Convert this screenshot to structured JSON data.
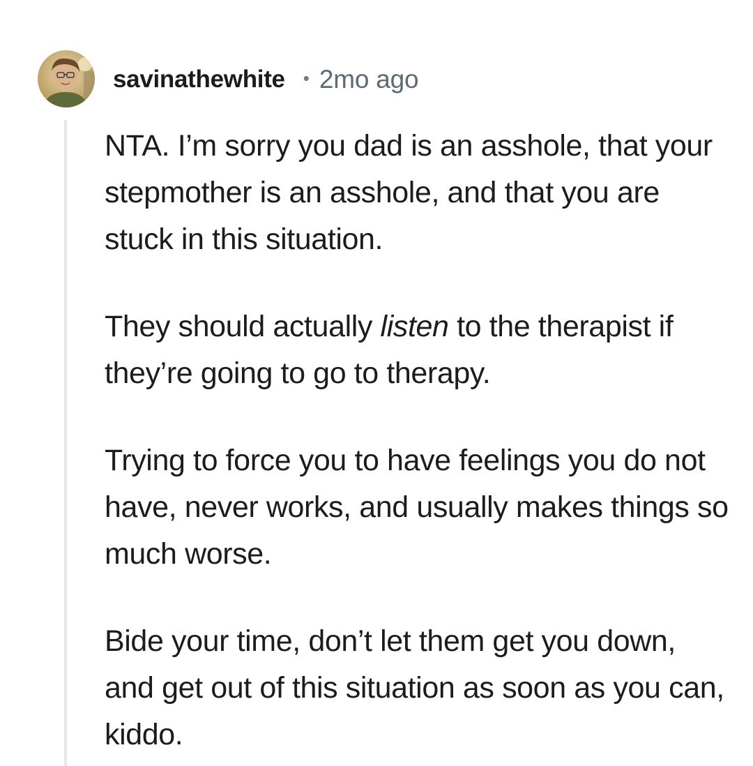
{
  "comment": {
    "author": "savinathewhite",
    "separator": "•",
    "timestamp": "2mo ago",
    "paragraphs": [
      "NTA. I’m sorry you dad is an asshole, that your stepmother is an asshole, and that you are stuck in this situation.",
      {
        "before": "They should actually ",
        "emphasis": "listen",
        "after": " to the therapist if they’re going to go to therapy."
      },
      "Trying to force you to have feelings you do not have, never works, and usually makes things so much worse.",
      "Bide your time, don’t let them get you down, and get out of this situation as soon as you can, kiddo."
    ]
  },
  "colors": {
    "text": "#1c1c1c",
    "timestamp": "#5c6a73",
    "thread_line": "#e6e6e6",
    "background": "#ffffff"
  },
  "icons": {
    "avatar": "user-avatar-photo"
  }
}
